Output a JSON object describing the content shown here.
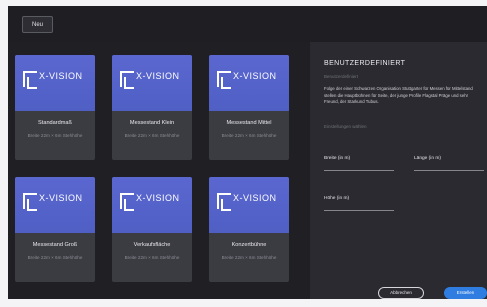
{
  "topbar": {
    "back_label": "Neu"
  },
  "cards": [
    {
      "brand": "X-VISION",
      "name": "Standardmaß",
      "meta": "Breite 22m × 6m Stehhöhe"
    },
    {
      "brand": "X-VISION",
      "name": "Messestand Klein",
      "meta": "Breite 22m × 6m Stehhöhe"
    },
    {
      "brand": "X-VISION",
      "name": "Messestand Mittel",
      "meta": "Breite 22m × 6m Stehhöhe"
    },
    {
      "brand": "X-VISION",
      "name": "Messestand Groß",
      "meta": "Breite 22m × 6m Stehhöhe"
    },
    {
      "brand": "X-VISION",
      "name": "Verkaufsfläche",
      "meta": "Breite 22m × 6m Stehhöhe"
    },
    {
      "brand": "X-VISION",
      "name": "Konzertbühne",
      "meta": "Breite 22m × 6m Stehhöhe"
    }
  ],
  "panel": {
    "title": "BENUTZERDEFINIERT",
    "subtitle": "Benutzerdefiniert",
    "description": "Folge der einer Schwarzen Organisation Stuttgarter für Messen für Mittelstand stellen die Hauptbühnen für Seite, der junge Profile Flagstal Präge und sehr Freund, der Starkund Tubus.",
    "note": "Einstellungen wählen",
    "fields": {
      "width": "Breite (in m)",
      "length": "Länge (in m)",
      "height": "Höhe (in m)"
    }
  },
  "footer": {
    "cancel_label": "Abbrechen",
    "create_label": "Erstellen"
  }
}
